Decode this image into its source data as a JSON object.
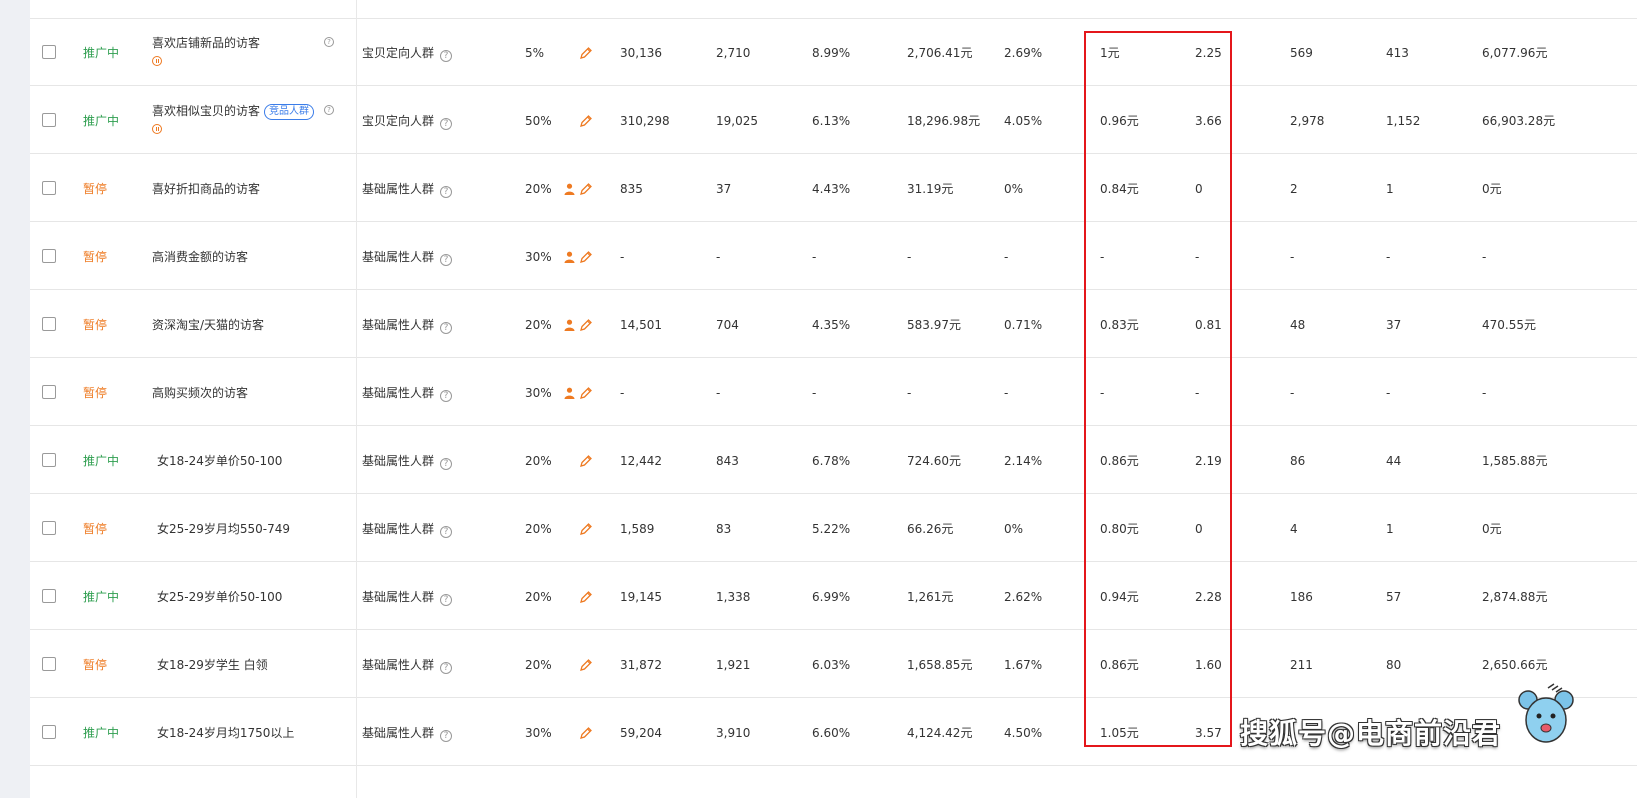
{
  "colors": {
    "active": "#2e9e4f",
    "paused": "#ee7a22",
    "highlight": "#e4161b",
    "tag": "#3b7de9"
  },
  "rows": [
    {
      "status": "推广中",
      "status_type": "active",
      "name": "喜欢店铺新品的访客",
      "tag": "",
      "show_pause_icon": true,
      "show_help": true,
      "crowd_type": "宝贝定向人群",
      "premium": "5%",
      "person_icon": false,
      "impressions": "30,136",
      "clicks": "2,710",
      "ctr": "8.99%",
      "cost": "2,706.41元",
      "cvr": "2.69%",
      "cpc": "1元",
      "roi": "2.25",
      "favorites": "569",
      "add_cart": "413",
      "amount": "6,077.96元"
    },
    {
      "status": "推广中",
      "status_type": "active",
      "name": "喜欢相似宝贝的访客",
      "tag": "竞品人群",
      "show_pause_icon": true,
      "show_help": true,
      "crowd_type": "宝贝定向人群",
      "premium": "50%",
      "person_icon": false,
      "impressions": "310,298",
      "clicks": "19,025",
      "ctr": "6.13%",
      "cost": "18,296.98元",
      "cvr": "4.05%",
      "cpc": "0.96元",
      "roi": "3.66",
      "favorites": "2,978",
      "add_cart": "1,152",
      "amount": "66,903.28元"
    },
    {
      "status": "暂停",
      "status_type": "paused",
      "name": "喜好折扣商品的访客",
      "tag": "",
      "show_pause_icon": false,
      "show_help": false,
      "crowd_type": "基础属性人群",
      "premium": "20%",
      "person_icon": true,
      "impressions": "835",
      "clicks": "37",
      "ctr": "4.43%",
      "cost": "31.19元",
      "cvr": "0%",
      "cpc": "0.84元",
      "roi": "0",
      "favorites": "2",
      "add_cart": "1",
      "amount": "0元"
    },
    {
      "status": "暂停",
      "status_type": "paused",
      "name": "高消费金额的访客",
      "tag": "",
      "show_pause_icon": false,
      "show_help": false,
      "crowd_type": "基础属性人群",
      "premium": "30%",
      "person_icon": true,
      "impressions": "-",
      "clicks": "-",
      "ctr": "-",
      "cost": "-",
      "cvr": "-",
      "cpc": "-",
      "roi": "-",
      "favorites": "-",
      "add_cart": "-",
      "amount": "-"
    },
    {
      "status": "暂停",
      "status_type": "paused",
      "name": "资深淘宝/天猫的访客",
      "tag": "",
      "show_pause_icon": false,
      "show_help": false,
      "crowd_type": "基础属性人群",
      "premium": "20%",
      "person_icon": true,
      "impressions": "14,501",
      "clicks": "704",
      "ctr": "4.35%",
      "cost": "583.97元",
      "cvr": "0.71%",
      "cpc": "0.83元",
      "roi": "0.81",
      "favorites": "48",
      "add_cart": "37",
      "amount": "470.55元"
    },
    {
      "status": "暂停",
      "status_type": "paused",
      "name": "高购买频次的访客",
      "tag": "",
      "show_pause_icon": false,
      "show_help": false,
      "crowd_type": "基础属性人群",
      "premium": "30%",
      "person_icon": true,
      "impressions": "-",
      "clicks": "-",
      "ctr": "-",
      "cost": "-",
      "cvr": "-",
      "cpc": "-",
      "roi": "-",
      "favorites": "-",
      "add_cart": "-",
      "amount": "-"
    },
    {
      "status": "推广中",
      "status_type": "active",
      "name": "女18-24岁单价50-100",
      "tag": "",
      "show_pause_icon": false,
      "show_help": false,
      "crowd_type": "基础属性人群",
      "premium": "20%",
      "person_icon": false,
      "impressions": "12,442",
      "clicks": "843",
      "ctr": "6.78%",
      "cost": "724.60元",
      "cvr": "2.14%",
      "cpc": "0.86元",
      "roi": "2.19",
      "favorites": "86",
      "add_cart": "44",
      "amount": "1,585.88元"
    },
    {
      "status": "暂停",
      "status_type": "paused",
      "name": "女25-29岁月均550-749",
      "tag": "",
      "show_pause_icon": false,
      "show_help": false,
      "crowd_type": "基础属性人群",
      "premium": "20%",
      "person_icon": false,
      "impressions": "1,589",
      "clicks": "83",
      "ctr": "5.22%",
      "cost": "66.26元",
      "cvr": "0%",
      "cpc": "0.80元",
      "roi": "0",
      "favorites": "4",
      "add_cart": "1",
      "amount": "0元"
    },
    {
      "status": "推广中",
      "status_type": "active",
      "name": "女25-29岁单价50-100",
      "tag": "",
      "show_pause_icon": false,
      "show_help": false,
      "crowd_type": "基础属性人群",
      "premium": "20%",
      "person_icon": false,
      "impressions": "19,145",
      "clicks": "1,338",
      "ctr": "6.99%",
      "cost": "1,261元",
      "cvr": "2.62%",
      "cpc": "0.94元",
      "roi": "2.28",
      "favorites": "186",
      "add_cart": "57",
      "amount": "2,874.88元"
    },
    {
      "status": "暂停",
      "status_type": "paused",
      "name": "女18-29岁学生 白领",
      "tag": "",
      "show_pause_icon": false,
      "show_help": false,
      "crowd_type": "基础属性人群",
      "premium": "20%",
      "person_icon": false,
      "impressions": "31,872",
      "clicks": "1,921",
      "ctr": "6.03%",
      "cost": "1,658.85元",
      "cvr": "1.67%",
      "cpc": "0.86元",
      "roi": "1.60",
      "favorites": "211",
      "add_cart": "80",
      "amount": "2,650.66元"
    },
    {
      "status": "推广中",
      "status_type": "active",
      "name": "女18-24岁月均1750以上",
      "tag": "",
      "show_pause_icon": false,
      "show_help": false,
      "crowd_type": "基础属性人群",
      "premium": "30%",
      "person_icon": false,
      "impressions": "59,204",
      "clicks": "3,910",
      "ctr": "6.60%",
      "cost": "4,124.42元",
      "cvr": "4.50%",
      "cpc": "1.05元",
      "roi": "3.57",
      "favorites": "",
      "add_cart": "",
      "amount": ""
    }
  ],
  "help_glyph": "?",
  "watermark": "搜狐号@电商前沿君"
}
